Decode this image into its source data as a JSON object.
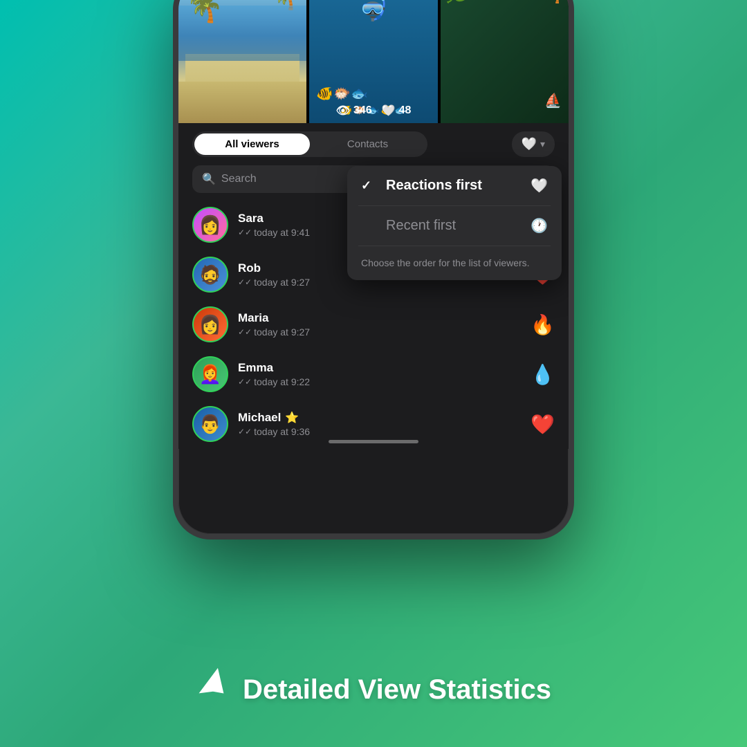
{
  "background": {
    "gradient_start": "#00c6b8",
    "gradient_end": "#5ac87a"
  },
  "bottom_title": {
    "icon": "✈",
    "text": "Detailed View Statistics"
  },
  "phone": {
    "photos": [
      {
        "type": "beach",
        "label": "beach photo"
      },
      {
        "type": "underwater",
        "label": "underwater photo"
      },
      {
        "type": "tropical",
        "label": "tropical photo"
      }
    ],
    "stats": {
      "views_icon": "👁",
      "views_count": "346",
      "likes_icon": "🤍",
      "likes_count": "48"
    },
    "tabs": {
      "all_viewers_label": "All viewers",
      "contacts_label": "Contacts"
    },
    "search_placeholder": "Search",
    "viewers": [
      {
        "id": "sara",
        "name": "Sara",
        "time": "today at 9:41",
        "reaction": null,
        "avatar_class": "sara"
      },
      {
        "id": "rob",
        "name": "Rob",
        "time": "today at 9:27",
        "reaction": "❤️",
        "avatar_class": "rob"
      },
      {
        "id": "maria",
        "name": "Maria",
        "time": "today at 9:27",
        "reaction": "🔥",
        "avatar_class": "maria"
      },
      {
        "id": "emma",
        "name": "Emma",
        "time": "today at 9:22",
        "reaction": "💧",
        "avatar_class": "emma"
      },
      {
        "id": "michael",
        "name": "Michael",
        "time": "today at 9:36",
        "reaction": "❤️",
        "has_badge": true,
        "avatar_class": "michael"
      }
    ],
    "dropdown": {
      "reactions_first_label": "Reactions first",
      "recent_first_label": "Recent first",
      "hint_text": "Choose the order for the list of viewers.",
      "selected": "reactions_first"
    }
  }
}
